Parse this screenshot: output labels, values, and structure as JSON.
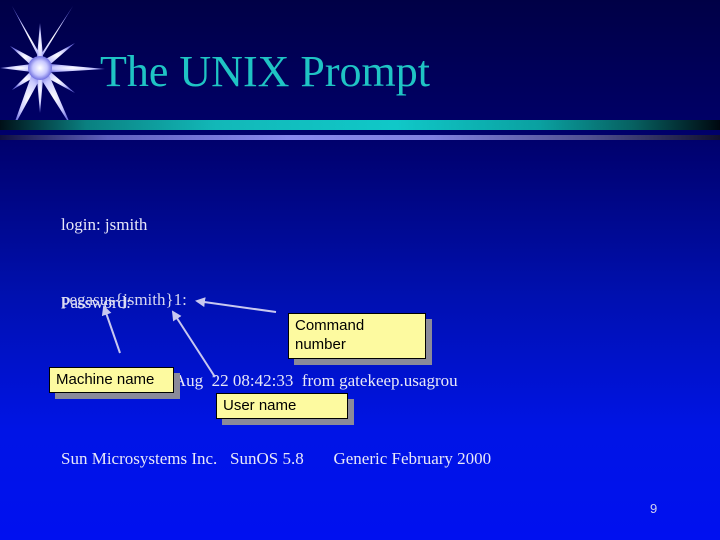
{
  "slide": {
    "title": "The UNIX Prompt",
    "lines": [
      "login: jsmith",
      "Password:",
      "Last login: Mon Aug  22 08:42:33  from gatekeep.usagrou",
      "Sun Microsystems Inc.   SunOS 5.8       Generic February 2000"
    ],
    "prompt": "pegasus{jsmith}1:",
    "callouts": {
      "command_number": [
        "Command",
        "number"
      ],
      "machine_name": "Machine name",
      "user_name": "User name"
    },
    "page_number": "9"
  },
  "colors": {
    "title": "#1fc4c4",
    "callout_fill": "#fdfaa0",
    "background_bottom": "#0010f0",
    "background_top": "#000046"
  }
}
